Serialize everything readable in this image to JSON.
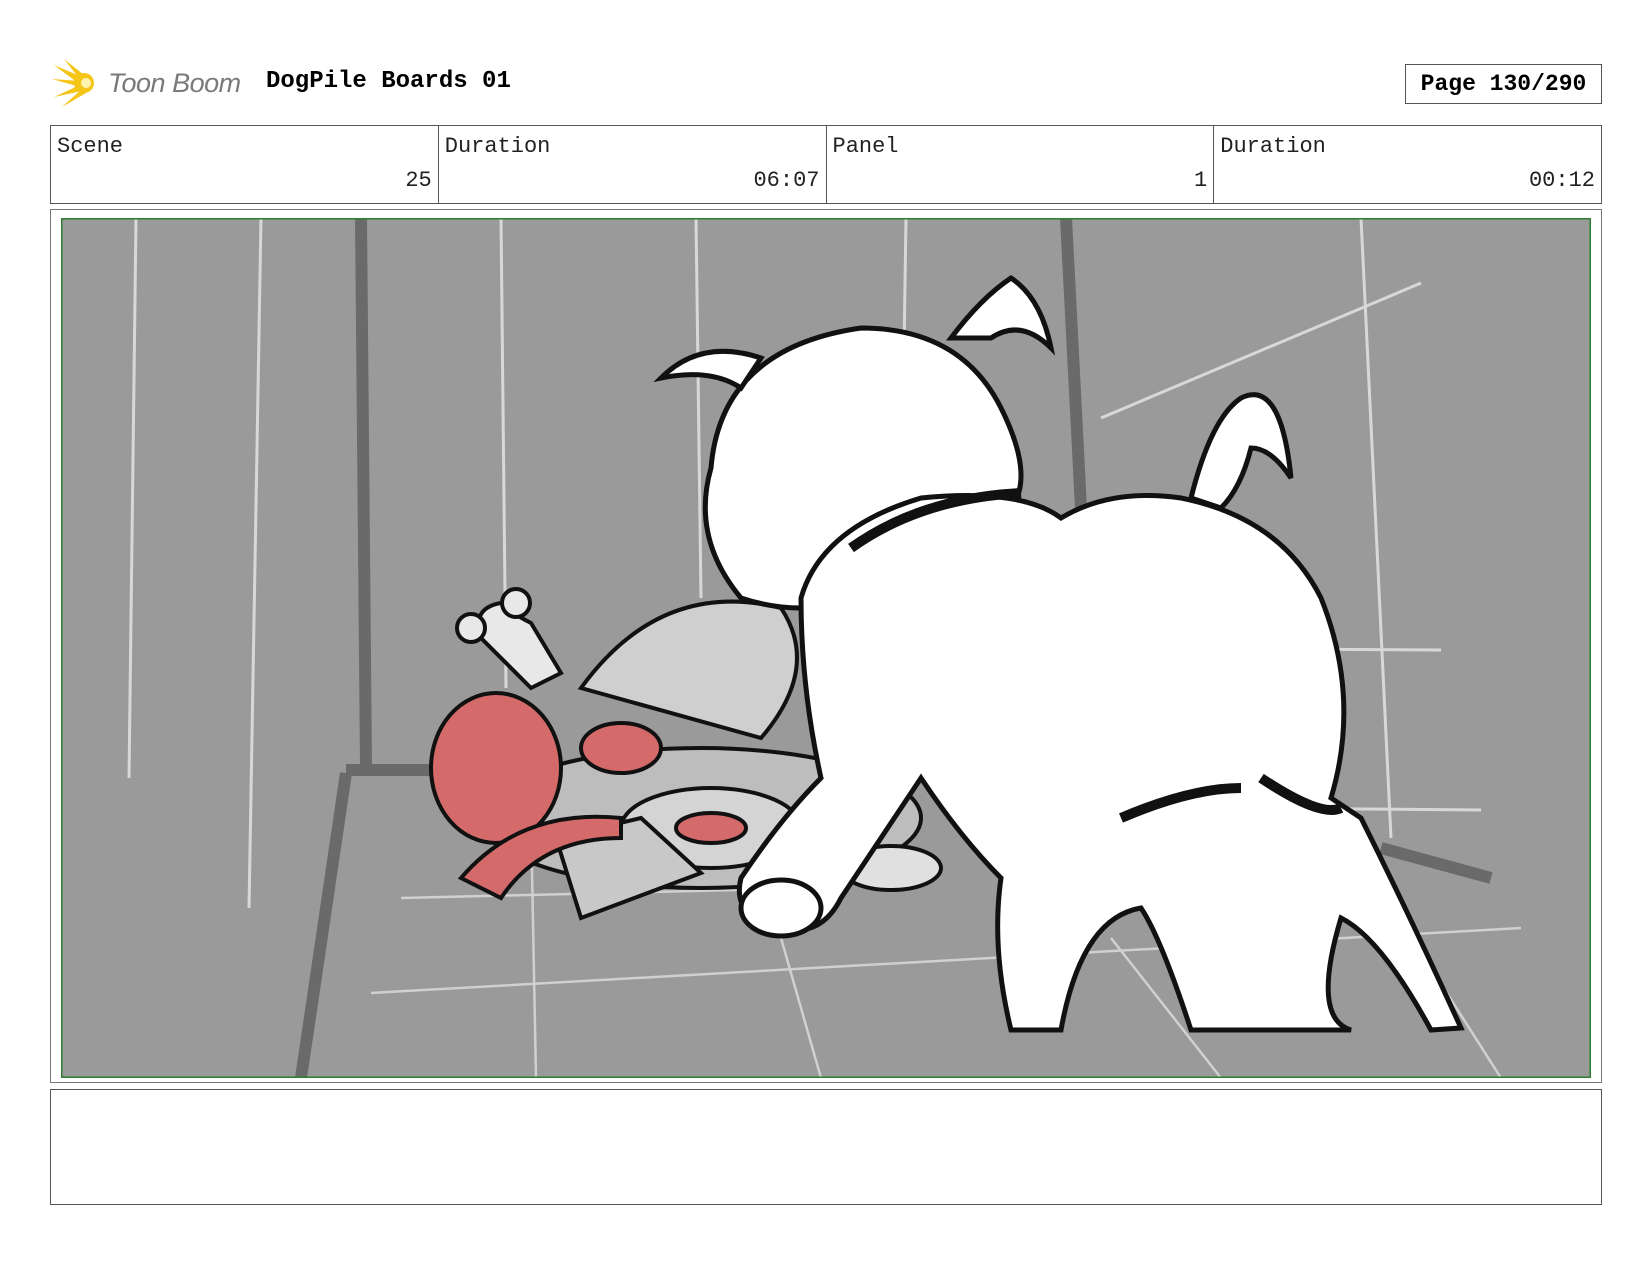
{
  "header": {
    "brand": "Toon Boom",
    "title": "DogPile Boards 01",
    "page": "Page 130/290"
  },
  "info": {
    "scene_label": "Scene",
    "scene_value": "25",
    "scene_duration_label": "Duration",
    "scene_duration_value": "06:07",
    "panel_label": "Panel",
    "panel_value": "1",
    "panel_duration_label": "Duration",
    "panel_duration_value": "00:12"
  },
  "notes": {
    "text": ""
  },
  "colors": {
    "logo": "#f5c518",
    "brand_text": "#7a7a7a",
    "panel_border": "#2e7d32",
    "background": "#9a9a9a",
    "meat": "#d46a6a"
  }
}
